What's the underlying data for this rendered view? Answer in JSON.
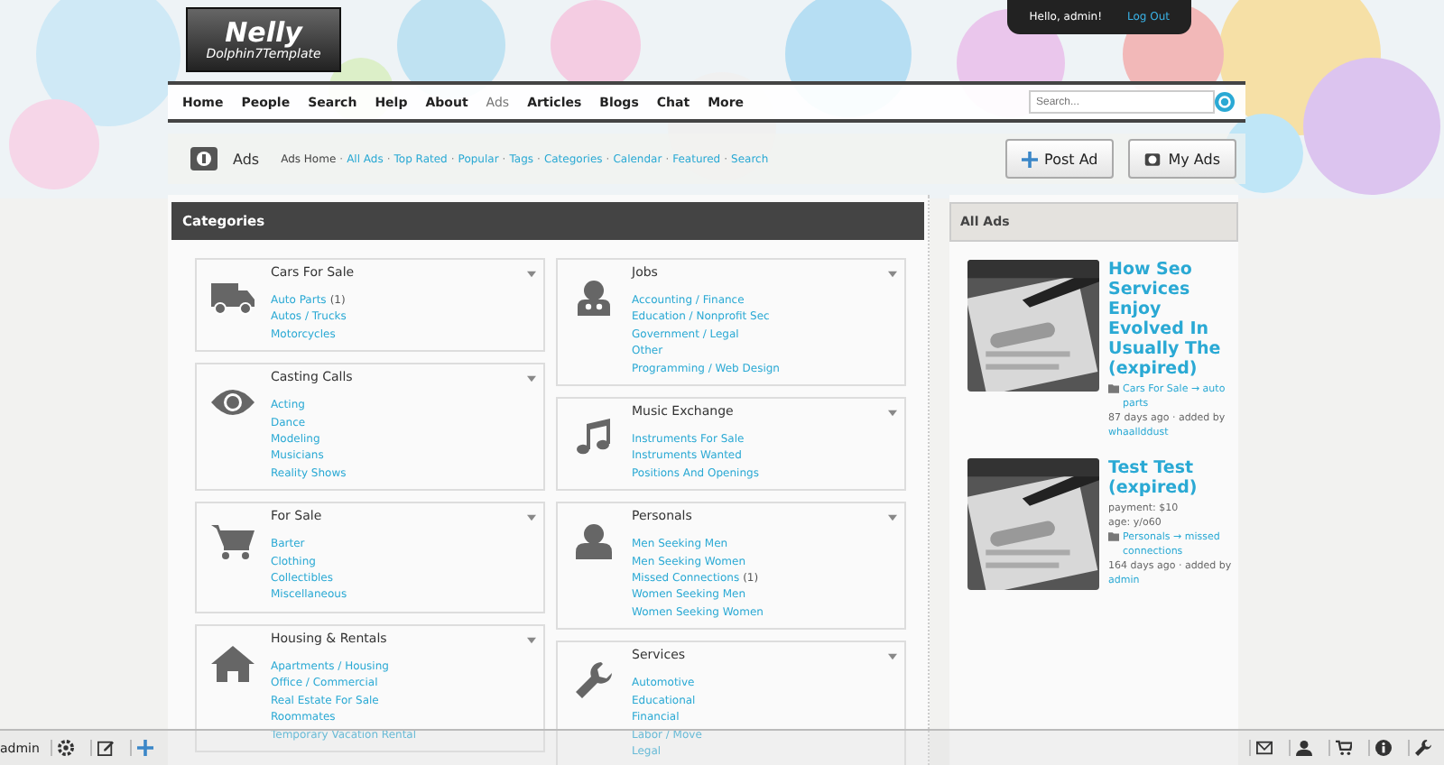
{
  "header": {
    "logo_title": "Nelly",
    "logo_subtitle": "Dolphin7Template",
    "greeting": "Hello, admin!",
    "logout": "Log Out"
  },
  "nav": {
    "items": [
      {
        "label": "Home",
        "selected": false
      },
      {
        "label": "People",
        "selected": false
      },
      {
        "label": "Search",
        "selected": false
      },
      {
        "label": "Help",
        "selected": false
      },
      {
        "label": "About",
        "selected": false
      },
      {
        "label": "Ads",
        "selected": true
      },
      {
        "label": "Articles",
        "selected": false
      },
      {
        "label": "Blogs",
        "selected": false
      },
      {
        "label": "Chat",
        "selected": false
      },
      {
        "label": "More",
        "selected": false
      }
    ],
    "search": {
      "placeholder": "Search..."
    }
  },
  "subnav": {
    "module": "Ads",
    "links": [
      {
        "label": "Ads Home",
        "selected": true
      },
      {
        "label": "All Ads",
        "selected": false
      },
      {
        "label": "Top Rated",
        "selected": false
      },
      {
        "label": "Popular",
        "selected": false
      },
      {
        "label": "Tags",
        "selected": false
      },
      {
        "label": "Categories",
        "selected": false
      },
      {
        "label": "Calendar",
        "selected": false
      },
      {
        "label": "Featured",
        "selected": false
      },
      {
        "label": "Search",
        "selected": false
      }
    ],
    "separator": "·",
    "buttons": [
      {
        "label": "Post Ad",
        "kind": "plus"
      },
      {
        "label": "My Ads",
        "kind": "ads"
      }
    ]
  },
  "categories": {
    "title": "Categories",
    "columns": [
      [
        {
          "title": "Cars For Sale",
          "kind": "truck",
          "items": [
            {
              "label": "Auto Parts",
              "count": "(1)"
            },
            {
              "label": "Autos / Trucks"
            },
            {
              "label": "Motorcycles"
            }
          ]
        },
        {
          "title": "Casting Calls",
          "kind": "eye",
          "items": [
            {
              "label": "Acting"
            },
            {
              "label": "Dance"
            },
            {
              "label": "Modeling"
            },
            {
              "label": "Musicians"
            },
            {
              "label": "Reality Shows"
            }
          ]
        },
        {
          "title": "For Sale",
          "kind": "cart",
          "items": [
            {
              "label": "Barter"
            },
            {
              "label": "Clothing"
            },
            {
              "label": "Collectibles"
            },
            {
              "label": "Miscellaneous"
            }
          ]
        },
        {
          "title": "Housing & Rentals",
          "kind": "house",
          "items": [
            {
              "label": "Apartments / Housing"
            },
            {
              "label": "Office / Commercial"
            },
            {
              "label": "Real Estate For Sale"
            },
            {
              "label": "Roommates"
            },
            {
              "label": "Temporary Vacation Rental"
            }
          ]
        }
      ],
      [
        {
          "title": "Jobs",
          "kind": "worker",
          "items": [
            {
              "label": "Accounting / Finance"
            },
            {
              "label": "Education / Nonprofit Sec"
            },
            {
              "label": "Government / Legal"
            },
            {
              "label": "Other"
            },
            {
              "label": "Programming / Web Design"
            }
          ]
        },
        {
          "title": "Music Exchange",
          "kind": "music",
          "items": [
            {
              "label": "Instruments For Sale"
            },
            {
              "label": "Instruments Wanted"
            },
            {
              "label": "Positions And Openings"
            }
          ]
        },
        {
          "title": "Personals",
          "kind": "person",
          "items": [
            {
              "label": "Men Seeking Men"
            },
            {
              "label": "Men Seeking Women"
            },
            {
              "label": "Missed Connections",
              "count": "(1)"
            },
            {
              "label": "Women Seeking Men"
            },
            {
              "label": "Women Seeking Women"
            }
          ]
        },
        {
          "title": "Services",
          "kind": "wrench",
          "items": [
            {
              "label": "Automotive"
            },
            {
              "label": "Educational"
            },
            {
              "label": "Financial"
            },
            {
              "label": "Labor / Move"
            },
            {
              "label": "Legal"
            }
          ]
        }
      ]
    ]
  },
  "all_ads": {
    "title": "All Ads",
    "ads": [
      {
        "title": "How Seo Services Enjoy Evolved In Usually The (expired)",
        "category": "Cars For Sale → auto parts",
        "meta": "87 days ago · added by",
        "author": "whaallddust"
      },
      {
        "title": "Test Test (expired)",
        "details": [
          "payment: $10",
          "age: y/o60"
        ],
        "category": "Personals → missed connections",
        "meta": "164 days ago · added by",
        "author": "admin"
      }
    ]
  },
  "toolbar": {
    "user": "admin"
  }
}
